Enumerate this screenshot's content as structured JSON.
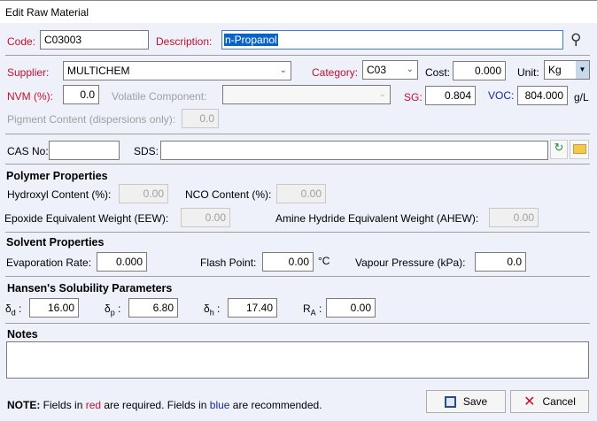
{
  "window": {
    "title": "Edit Raw Material"
  },
  "code": {
    "label": "Code:",
    "value": "C03003"
  },
  "description": {
    "label": "Description:",
    "value": "n-Propanol"
  },
  "supplier": {
    "label": "Supplier:",
    "value": "MULTICHEM"
  },
  "category": {
    "label": "Category:",
    "value": "C03"
  },
  "cost": {
    "label": "Cost:",
    "value": "0.000"
  },
  "unit": {
    "label": "Unit:",
    "value": "Kg"
  },
  "nvm": {
    "label": "NVM (%):",
    "value": "0.0"
  },
  "volatile": {
    "label": "Volatile Component:",
    "value": ""
  },
  "sg": {
    "label": "SG:",
    "value": "0.804"
  },
  "voc": {
    "label": "VOC:",
    "value": "804.000",
    "unit": "g/L"
  },
  "pigment": {
    "label": "Pigment Content (dispersions only):",
    "value": "0.0"
  },
  "cas": {
    "label": "CAS No:",
    "value": ""
  },
  "sds": {
    "label": "SDS:",
    "value": ""
  },
  "polymer": {
    "heading": "Polymer Properties",
    "hydroxyl_label": "Hydroxyl Content (%):",
    "hydroxyl": "0.00",
    "nco_label": "NCO Content (%):",
    "nco": "0.00",
    "eew_label": "Epoxide Equivalent Weight (EEW):",
    "eew": "0.00",
    "ahew_label": "Amine Hydride Equivalent Weight (AHEW):",
    "ahew": "0.00"
  },
  "solvent": {
    "heading": "Solvent Properties",
    "evap_label": "Evaporation Rate:",
    "evap": "0.000",
    "flash_label": "Flash Point:",
    "flash": "0.00",
    "flash_unit": "°C",
    "vp_label": "Vapour Pressure (kPa):",
    "vp": "0.0"
  },
  "hansen": {
    "heading": "Hansen's Solubility Parameters",
    "d_sym": "δ",
    "d_sub": "d",
    "d": "16.00",
    "p_sym": "δ",
    "p_sub": "p",
    "p": "6.80",
    "h_sym": "δ",
    "h_sub": "h",
    "h": "17.40",
    "ra_sym": "R",
    "ra_sub": "A",
    "ra": "0.00"
  },
  "notes": {
    "heading": "Notes",
    "value": ""
  },
  "footer": {
    "note_bold": "NOTE:",
    "note1": " Fields in ",
    "red": "red",
    "note2": " are required. Fields in ",
    "blue": "blue",
    "note3": " are recommended.",
    "save": "Save",
    "cancel": "Cancel"
  }
}
